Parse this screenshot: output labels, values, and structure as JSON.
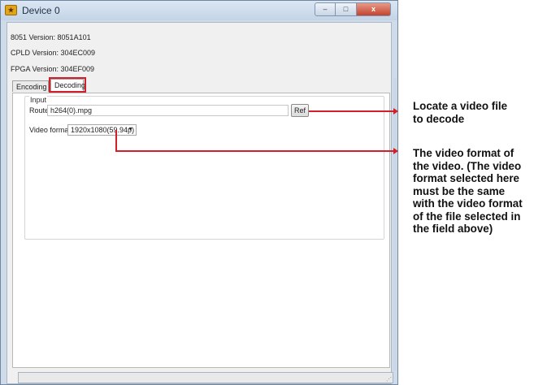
{
  "window": {
    "title": "Device 0",
    "controls": {
      "minimize": "–",
      "maximize": "□",
      "close": "x"
    }
  },
  "info": {
    "version_8051": "8051 Version: 8051A101",
    "version_cpld": "CPLD Version: 304EC009",
    "version_fpga": "FPGA Version: 304EF009"
  },
  "tabs": [
    {
      "label": "Encoding",
      "active": false
    },
    {
      "label": "Decoding",
      "active": true
    }
  ],
  "input_group": {
    "label": "Input",
    "route_label": "Route",
    "route_value": "h264(0).mpg",
    "ref_button": "Ref",
    "format_label": "Video format",
    "format_value": "1920x1080(59.94p)"
  },
  "annotations": {
    "locate": [
      "Locate a video file",
      "to decode"
    ],
    "format": [
      "The video format of",
      "the video. (The video",
      "format selected here",
      "must be the same",
      "with the video format",
      "of the file selected in",
      "the field above)"
    ]
  },
  "colors": {
    "highlight": "#d2202a",
    "arrow": "#d2202a"
  }
}
